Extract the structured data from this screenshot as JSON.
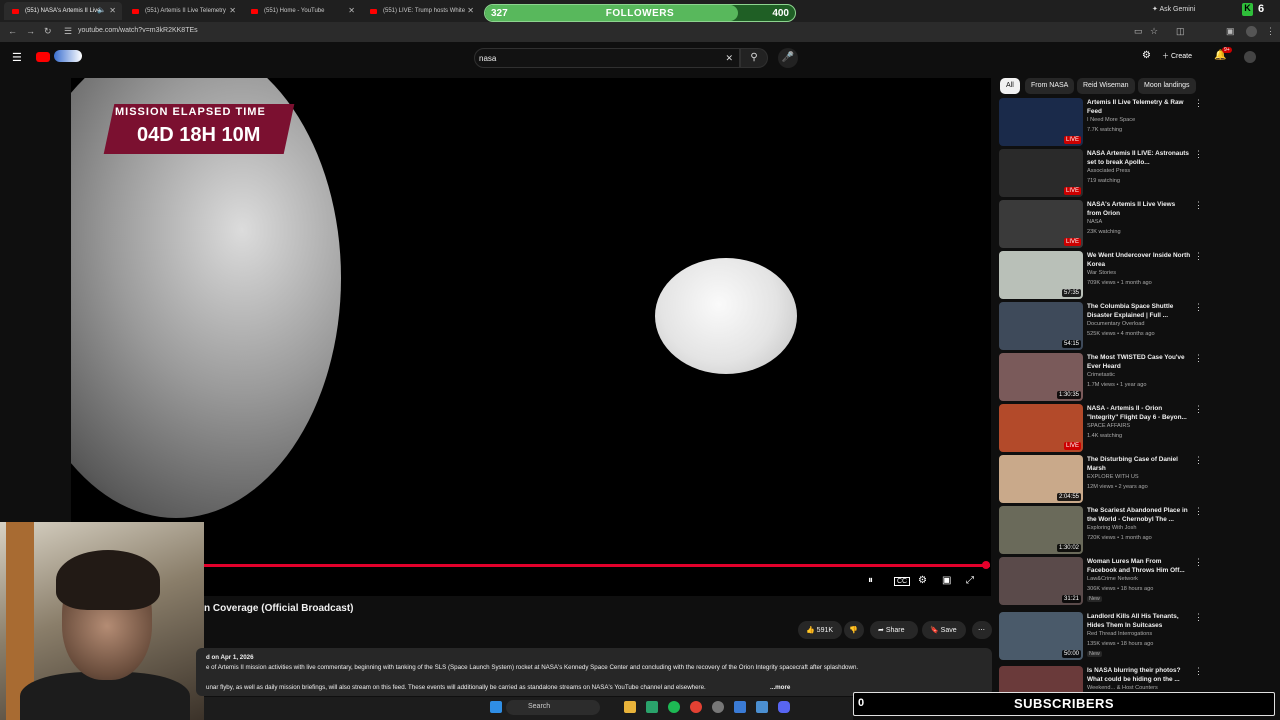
{
  "browser": {
    "tabs": [
      {
        "title": "(551) NASA's Artemis II Live",
        "active": true
      },
      {
        "title": "(551) Artemis II Live Telemetry"
      },
      {
        "title": "(551) Home - YouTube"
      },
      {
        "title": "(551) LIVE: Trump hosts White"
      }
    ],
    "url": "youtube.com/watch?v=m3kR2KK8TEs",
    "ask_gemini": "Ask Gemini",
    "ext_count": "6"
  },
  "followers_overlay": {
    "current": "327",
    "label": "FOLLOWERS",
    "goal": "400",
    "progress": 0.8175
  },
  "header": {
    "search_value": "nasa",
    "create_label": "Create",
    "notif_badge": "9+"
  },
  "player": {
    "met_title": "MISSION ELAPSED TIME",
    "met_time": "04D 18H 10M",
    "progress": 0.99
  },
  "video": {
    "title": "n Coverage (Official Broadcast)",
    "likes": "591K",
    "share_label": "Share",
    "save_label": "Save",
    "date": "d on Apr 1, 2026",
    "desc_line1": "e of Artemis II mission activities with live commentary, beginning with tanking of the SLS (Space Launch System) rocket at NASA's Kennedy Space Center and concluding with the recovery of the Orion Integrity spacecraft after splashdown.",
    "desc_line2": "unar flyby, as well as daily mission briefings, will also stream on this feed. These events will additionally be carried as standalone streams on NASA's YouTube channel and elsewhere.",
    "more_label": "...more"
  },
  "chips": [
    "All",
    "From NASA",
    "Reid Wiseman",
    "Moon landings"
  ],
  "recommendations": [
    {
      "title": "Artemis II Live Telemetry & Raw Feed",
      "channel": "I Need More Space",
      "meta": "7.7K watching",
      "badge": "LIVE",
      "color": "#1a2a4a"
    },
    {
      "title": "NASA Artemis II LIVE: Astronauts set to break Apollo...",
      "channel": "Associated Press",
      "meta": "719 watching",
      "badge": "LIVE",
      "color": "#2a2a2a"
    },
    {
      "title": "NASA's Artemis II Live Views from Orion",
      "channel": "NASA",
      "meta": "23K watching",
      "badge": "LIVE",
      "color": "#3a3a3a"
    },
    {
      "title": "We Went Undercover Inside North Korea",
      "channel": "War Stories",
      "meta": "709K views • 1 month ago",
      "badge": "57:35",
      "color": "#b9c0b8"
    },
    {
      "title": "The Columbia Space Shuttle Disaster Explained | Full ...",
      "channel": "Documentary Overload",
      "meta": "525K views • 4 months ago",
      "badge": "54:15",
      "color": "#3e4a5a"
    },
    {
      "title": "The Most TWISTED Case You've Ever Heard",
      "channel": "Crimetastic",
      "meta": "1.7M views • 1 year ago",
      "badge": "1:30:35",
      "color": "#7a5a5a"
    },
    {
      "title": "NASA - Artemis II - Orion \"Integrity\" Flight Day 6 - Beyon...",
      "channel": "SPACE AFFAIRS",
      "meta": "1.4K watching",
      "badge": "LIVE",
      "color": "#b34a2a"
    },
    {
      "title": "The Disturbing Case of Daniel Marsh",
      "channel": "EXPLORE WITH US",
      "meta": "12M views • 2 years ago",
      "badge": "2:04:55",
      "color": "#c9a98a"
    },
    {
      "title": "The Scariest Abandoned Place in the World - Chernobyl The ...",
      "channel": "Exploring With Josh",
      "meta": "720K views • 1 month ago",
      "badge": "1:30:02",
      "color": "#6a6a5a"
    },
    {
      "title": "Woman Lures Man From Facebook and Throws Him Off...",
      "channel": "Law&Crime Network",
      "meta": "306K views • 18 hours ago",
      "badge": "31:21",
      "new": "New",
      "color": "#5a4a4a"
    },
    {
      "title": "Landlord Kills All His Tenants, Hides Them In Suitcases",
      "channel": "Red Thread Interrogations",
      "meta": "135K views • 18 hours ago",
      "badge": "50:00",
      "new": "New",
      "color": "#4a5a6a"
    },
    {
      "title": "Is NASA blurring their photos? What could be hiding on the ...",
      "channel": "Weekend... & Host Counters",
      "meta": "",
      "badge": "",
      "color": "#6a3a3a"
    }
  ],
  "subscribers_overlay": {
    "count": "0",
    "label": "SUBSCRIBERS"
  },
  "taskbar": {
    "search_label": "Search"
  }
}
